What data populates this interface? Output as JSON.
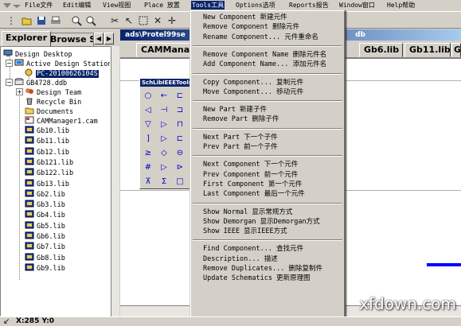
{
  "menubar": {
    "items": [
      "File文件",
      "Edit编辑",
      "View视图",
      "Place 放置",
      "Tools工具",
      "Options选项",
      "Reports报告",
      "Window窗口",
      "Help帮助"
    ]
  },
  "toolbar": {
    "icons": [
      "open-folder-icon",
      "save-icon",
      "print-icon",
      "zoom-in-icon",
      "zoom-out-icon",
      "cut-icon",
      "pointer-icon",
      "select-area-icon",
      "cross-icon",
      "move-icon"
    ]
  },
  "left_panel": {
    "tabs": [
      "Explorer",
      "Browse S"
    ],
    "tree": [
      {
        "label": "Design Desktop",
        "icon": "desktop-icon"
      },
      {
        "label": "Active Design Station",
        "icon": "station-icon"
      },
      {
        "label": "PC-20100626104S",
        "icon": "pc-icon"
      },
      {
        "label": "GB4728.ddb",
        "icon": "database-icon"
      },
      {
        "label": "Design Team",
        "icon": "team-icon"
      },
      {
        "label": "Recycle Bin",
        "icon": "recycle-icon"
      },
      {
        "label": "Documents",
        "icon": "folder-icon"
      },
      {
        "label": "CAMManager1.cam",
        "icon": "cam-icon"
      },
      {
        "label": "Gb10.lib",
        "icon": "lib-icon"
      },
      {
        "label": "Gb11.lib",
        "icon": "lib-icon"
      },
      {
        "label": "Gb12.lib",
        "icon": "lib-icon"
      },
      {
        "label": "Gb121.lib",
        "icon": "lib-icon"
      },
      {
        "label": "Gb122.lib",
        "icon": "lib-icon"
      },
      {
        "label": "Gb13.lib",
        "icon": "lib-icon"
      },
      {
        "label": "Gb2.lib",
        "icon": "lib-icon"
      },
      {
        "label": "Gb3.lib",
        "icon": "lib-icon"
      },
      {
        "label": "Gb4.lib",
        "icon": "lib-icon"
      },
      {
        "label": "Gb5.lib",
        "icon": "lib-icon"
      },
      {
        "label": "Gb6.lib",
        "icon": "lib-icon"
      },
      {
        "label": "Gb7.lib",
        "icon": "lib-icon"
      },
      {
        "label": "Gb8.lib",
        "icon": "lib-icon"
      },
      {
        "label": "Gb9.lib",
        "icon": "lib-icon"
      }
    ]
  },
  "document": {
    "title": "ads\\Protel99se",
    "title_right": "db",
    "tabs": [
      "CAMManage",
      "Gb6.lib",
      "Gb11.lib",
      "G"
    ]
  },
  "toolbox": {
    "title": "SchLibIEEETools"
  },
  "dropdown": {
    "groups": [
      [
        "New Component 新建元件",
        "Remove Component 删除元件",
        "Rename Component... 元件重命名"
      ],
      [
        "Remove Component Name 删除元件名",
        "Add Component Name... 添加元件名"
      ],
      [
        "Copy Component... 复制元件",
        "Move Component... 移动元件"
      ],
      [
        "New Part 新建子件",
        "Remove Part 删除子件"
      ],
      [
        "Next Part 下一个子件",
        "Prev Part 前一个子件"
      ],
      [
        "Next Component 下一个元件",
        "Prev Component 前一个元件",
        "First Component 第一个元件",
        "Last Component 最后一个元件"
      ],
      [
        "Show Normal 显示常规方式",
        "Show Demorgan 显示Demorgan方式",
        "Show IEEE 显示IEEE方式"
      ],
      [
        "Find Component... 查找元件",
        "Description... 描述",
        "Remove Duplicates... 删除复制件",
        "Update Schematics 更新原理图"
      ]
    ]
  },
  "statusbar": {
    "coords": "X:285 Y:0"
  },
  "watermark": "xfdown.com",
  "colors": {
    "chrome": "#d4d0c8",
    "title_bar": "#0a246a",
    "selection": "#0a246a",
    "canvas": "#ffffff"
  }
}
